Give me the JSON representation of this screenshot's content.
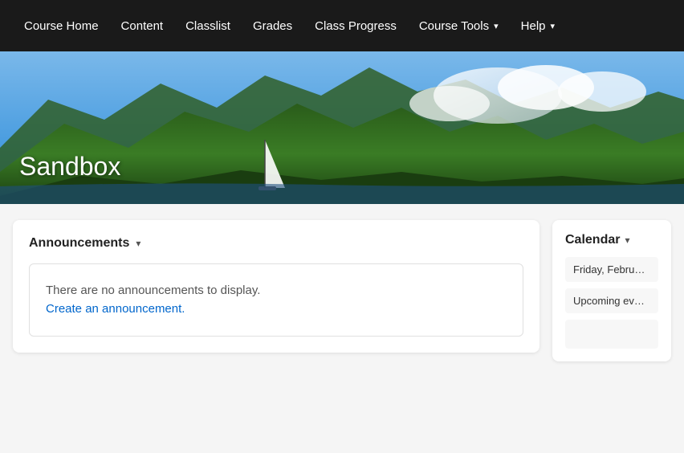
{
  "nav": {
    "items": [
      {
        "label": "Course Home",
        "active": false,
        "hasChevron": false
      },
      {
        "label": "Content",
        "active": false,
        "hasChevron": false
      },
      {
        "label": "Classlist",
        "active": false,
        "hasChevron": false
      },
      {
        "label": "Grades",
        "active": false,
        "hasChevron": false
      },
      {
        "label": "Class Progress",
        "active": false,
        "hasChevron": false
      },
      {
        "label": "Course Tools",
        "active": false,
        "hasChevron": true
      },
      {
        "label": "Help",
        "active": false,
        "hasChevron": true
      }
    ]
  },
  "hero": {
    "title": "Sandbox"
  },
  "announcements": {
    "title": "Announcements",
    "chevron": "▾",
    "empty_text": "There are no announcements to display.",
    "create_link": "Create an announcement."
  },
  "calendar": {
    "title": "Calendar",
    "chevron": "▾",
    "date_label": "Friday, Februa…",
    "upcoming_label": "Upcoming ev…"
  }
}
